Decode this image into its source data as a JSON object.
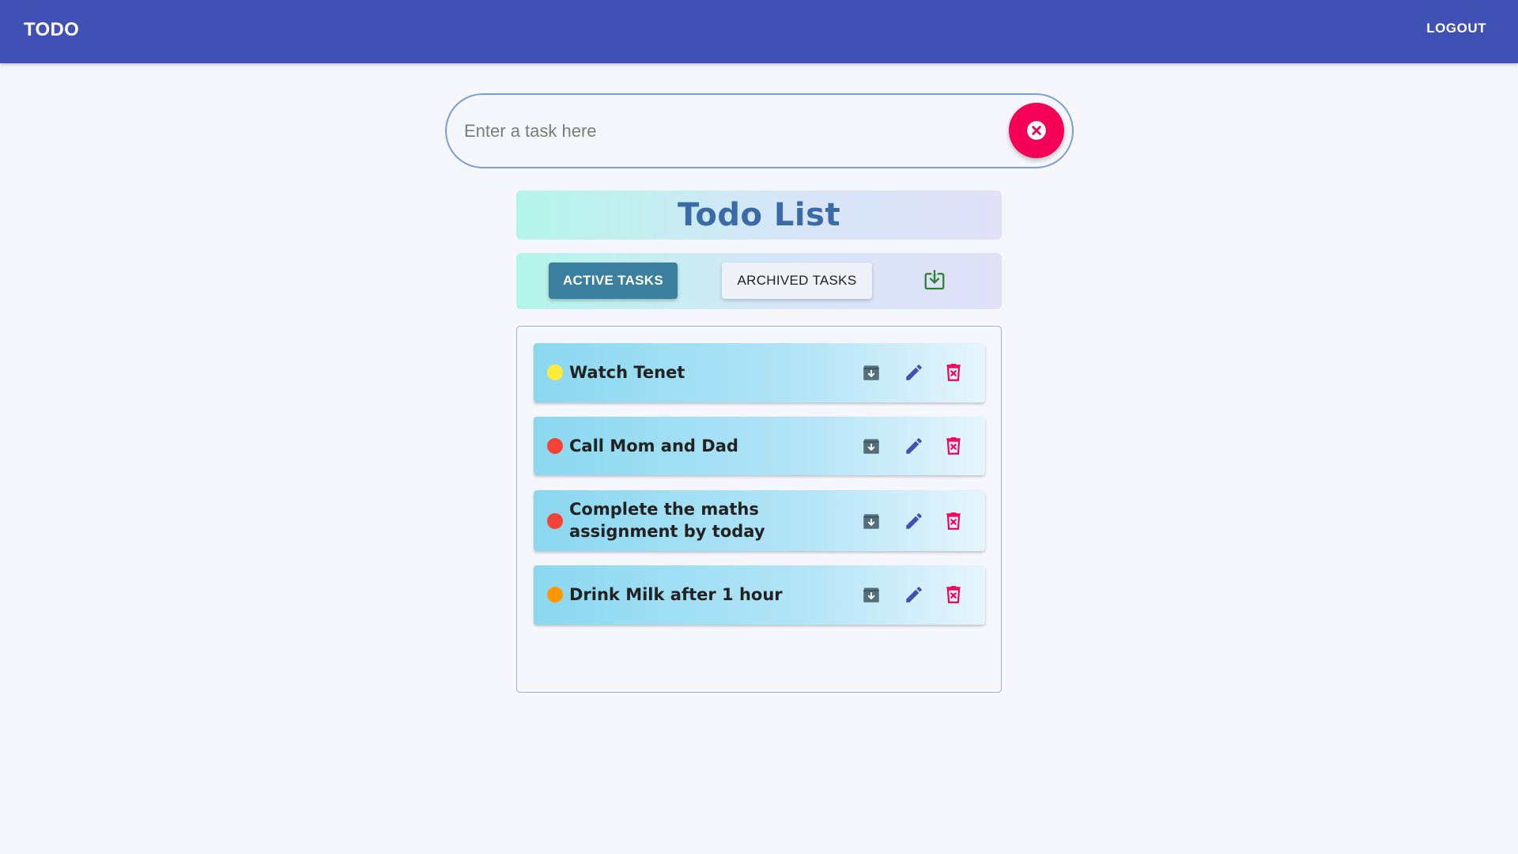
{
  "appbar": {
    "brand": "TODO",
    "logout_label": "LOGOUT",
    "bg_color": "#3f51b5"
  },
  "task_input": {
    "placeholder": "Enter a task here",
    "value": "",
    "clear_icon": "close-circle-icon",
    "clear_color": "#f50057"
  },
  "title": "Todo List",
  "tabs": {
    "active_label": "ACTIVE TASKS",
    "archived_label": "ARCHIVED TASKS",
    "selected": "ACTIVE TASKS",
    "download_icon": "download-icon"
  },
  "tasks": [
    {
      "text": "Watch Tenet",
      "priority_color": "#ffeb3b"
    },
    {
      "text": "Call Mom and Dad",
      "priority_color": "#f44336"
    },
    {
      "text": "Complete the maths assignment by today",
      "priority_color": "#f44336"
    },
    {
      "text": "Drink Milk after 1 hour",
      "priority_color": "#ff9800"
    }
  ],
  "task_actions": {
    "archive_icon": "archive-icon",
    "edit_icon": "pencil-icon",
    "delete_icon": "trash-icon"
  }
}
